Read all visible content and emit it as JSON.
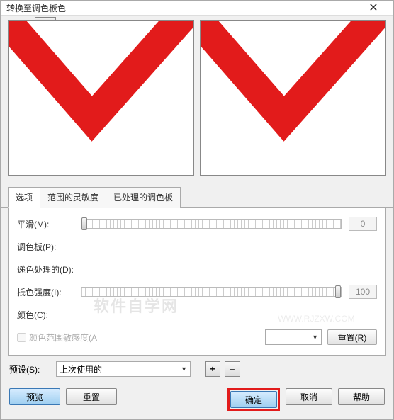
{
  "title": "转换至调色板色",
  "tabs": {
    "t1": "选项",
    "t2": "范围的灵敏度",
    "t3": "已处理的调色板"
  },
  "labels": {
    "smooth": "平滑(M):",
    "palette": "调色板(P):",
    "dither": "递色处理的(D):",
    "intensity": "抵色强度(I):",
    "color": "颜色(C):",
    "rangeCheckbox": "颜色范围敏感度(A",
    "preset": "预设(S):"
  },
  "values": {
    "smooth": "0",
    "intensity": "100",
    "preset": "上次使用的"
  },
  "buttons": {
    "resetR": "重置(R)",
    "preview": "预览",
    "reset": "重置",
    "ok": "确定",
    "cancel": "取消",
    "help": "帮助",
    "plus": "+",
    "minus": "–"
  },
  "colors": {
    "shape": "#e21b1b"
  }
}
